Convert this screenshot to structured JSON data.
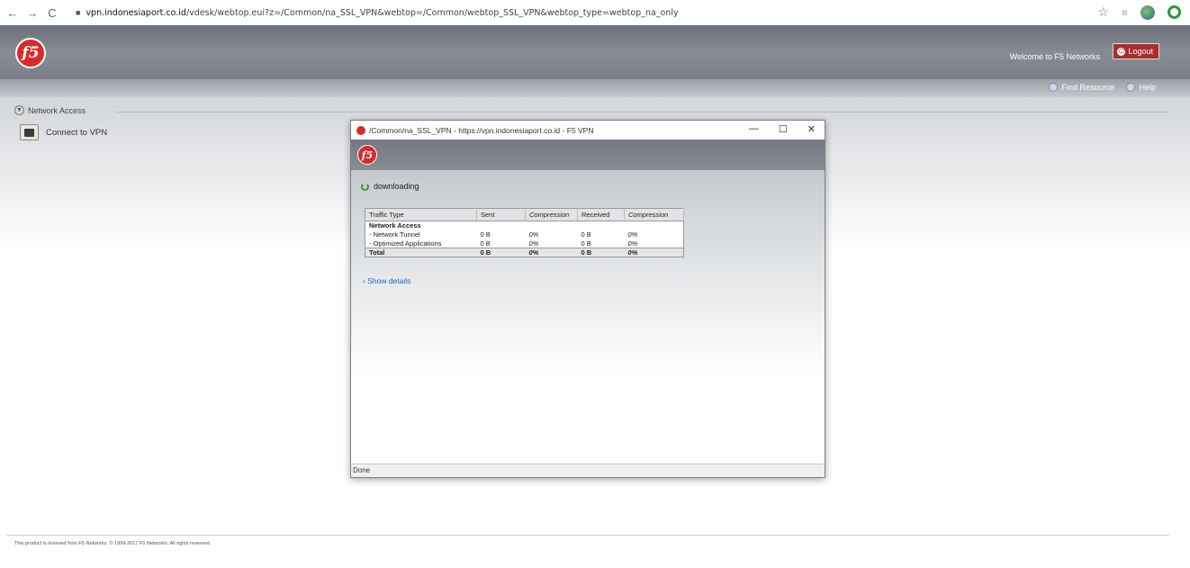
{
  "browser": {
    "back": "←",
    "forward": "→",
    "reload": "C",
    "url_host": "vpn.indonesiaport.co.id",
    "url_path": "/vdesk/webtop.eui?z=/Common/na_SSL_VPN&webtop=/Common/webtop_SSL_VPN&webtop_type=webtop_na_only"
  },
  "header": {
    "logo_text": "f5",
    "welcome": "Welcome to F5 Networks",
    "logout": "Logout",
    "find_resource": "Find Resource",
    "help": "Help"
  },
  "section": {
    "title": "Network Access",
    "item_label": "Connect to VPN"
  },
  "popup": {
    "title": "/Common/na_SSL_VPN - https://vpn.indonesiaport.co.id - F5 VPN",
    "logo_text": "f5",
    "status": "downloading",
    "columns": [
      "Traffic Type",
      "Sent",
      "Compression",
      "Received",
      "Compression"
    ],
    "rows": [
      {
        "type": "Network Access",
        "sent": "",
        "comp1": "",
        "recv": "",
        "comp2": ""
      },
      {
        "type": "- Network Tunnel",
        "sent": "0 B",
        "comp1": "0%",
        "recv": "0 B",
        "comp2": "0%"
      },
      {
        "type": "- Optimized Applications",
        "sent": "0 B",
        "comp1": "0%",
        "recv": "0 B",
        "comp2": "0%"
      },
      {
        "type": "Total",
        "sent": "0 B",
        "comp1": "0%",
        "recv": "0 B",
        "comp2": "0%"
      }
    ],
    "show_details": "› Show details",
    "statusbar": "Done"
  },
  "footer": {
    "text": "This product is licensed from F5 Networks. © 1999-2017 F5 Networks. All rights reserved."
  },
  "colors": {
    "brand_red": "#d82b2b",
    "header_gray": "#7b8088",
    "link_blue": "#2a63b8"
  }
}
